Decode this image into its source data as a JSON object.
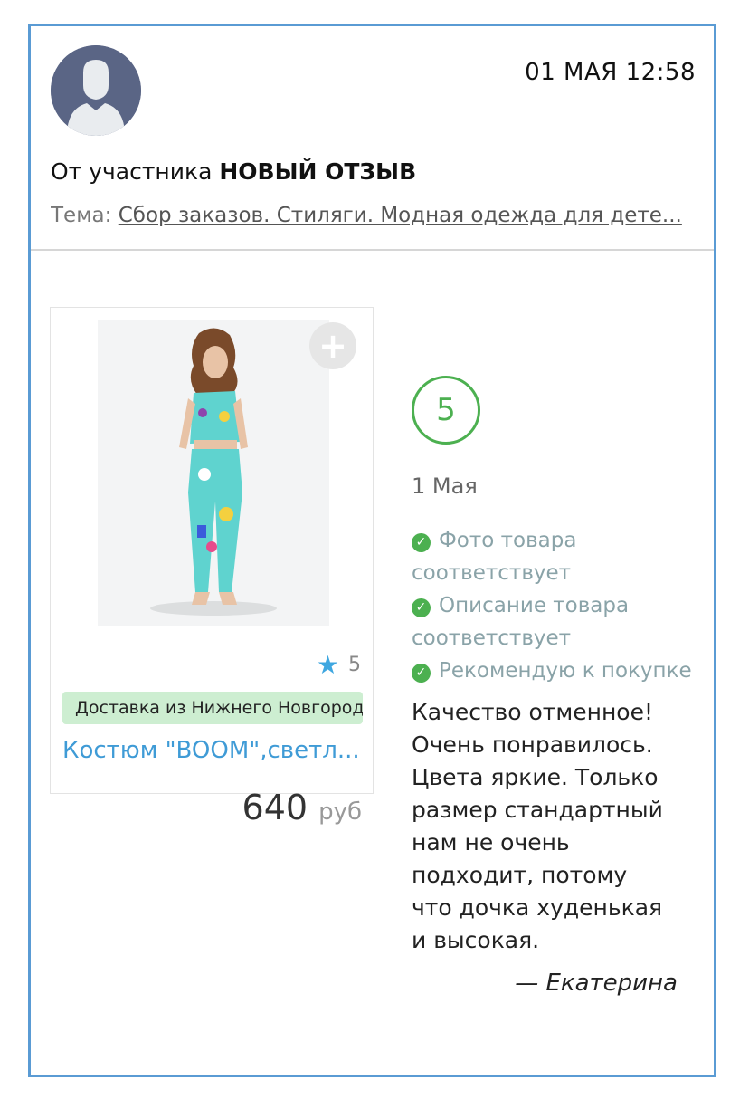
{
  "header": {
    "datetime": "01 МАЯ 12:58",
    "from_prefix": "От участника",
    "from_name": "НОВЫЙ ОТЗЫВ",
    "topic_label": "Тема:",
    "topic_link": "Сбор заказов. Стиляги. Модная одежда для дете..."
  },
  "product": {
    "rating": "5",
    "delivery": "Доставка из Нижнего Новгорода",
    "name": "Костюм \"BOOM\",светл...",
    "price": "640",
    "currency": "руб"
  },
  "review": {
    "score": "5",
    "date": "1 Мая",
    "checks": [
      "Фото товара соответствует",
      "Описание товара соответствует",
      "Рекомендую к покупке"
    ],
    "text": "Качество отменное! Очень понравилось. Цвета яркие. Только размер стандартный нам не очень подходит, потому что дочка худенькая и высокая.",
    "author": "— Екатерина"
  },
  "colors": {
    "border": "#5a9bd4",
    "accent_green": "#4cb050",
    "link_blue": "#3f9bd6",
    "star_blue": "#3fa7e0",
    "delivery_bg": "#cdeed1"
  },
  "icons": [
    "avatar-placeholder",
    "plus-icon",
    "star-icon",
    "check-icon"
  ]
}
